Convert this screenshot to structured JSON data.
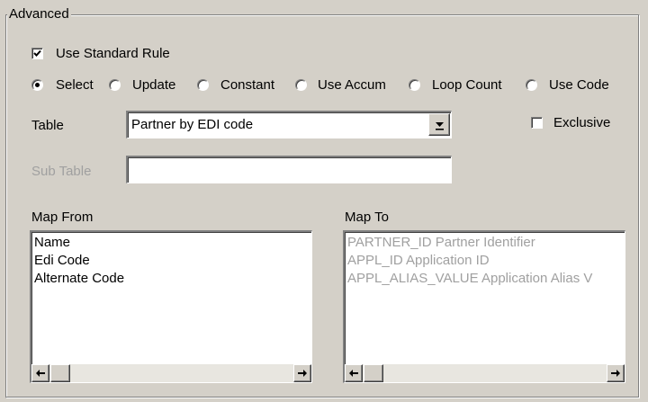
{
  "group": {
    "title": "Advanced"
  },
  "use_standard_rule": {
    "label": "Use Standard Rule",
    "checked": true
  },
  "rule_types": [
    {
      "label": "Select",
      "selected": true
    },
    {
      "label": "Update",
      "selected": false
    },
    {
      "label": "Constant",
      "selected": false
    },
    {
      "label": "Use Accum",
      "selected": false
    },
    {
      "label": "Loop Count",
      "selected": false
    },
    {
      "label": "Use Code",
      "selected": false
    }
  ],
  "table": {
    "label": "Table",
    "value": "Partner by EDI code"
  },
  "exclusive": {
    "label": "Exclusive",
    "checked": false
  },
  "sub_table": {
    "label": "Sub Table",
    "value": ""
  },
  "map_from": {
    "label": "Map From",
    "items": [
      "Name",
      "Edi Code",
      "Alternate Code"
    ]
  },
  "map_to": {
    "label": "Map To",
    "items": [
      "PARTNER_ID Partner Identifier",
      "APPL_ID Application ID",
      "APPL_ALIAS_VALUE Application Alias V"
    ]
  },
  "icons": {
    "checkbox": "check-mark-icon",
    "dropdown": "dropdown-arrow-icon",
    "scroll_left": "scroll-left-arrow-icon",
    "scroll_right": "scroll-right-arrow-icon"
  }
}
